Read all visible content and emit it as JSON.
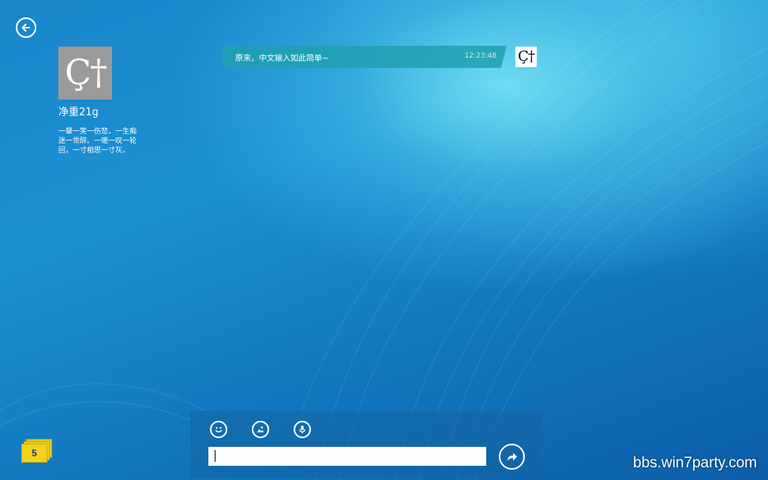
{
  "navigation": {
    "back_icon": "back-arrow-icon"
  },
  "profile": {
    "avatar_glyph": "Ç†",
    "name": "净重21g",
    "bio": "一颦一笑一伤悲，一生痴迷一世醉。一嗟一叹一轮回，一寸相思一寸灰。"
  },
  "conversation": {
    "messages": [
      {
        "text": "原来，中文输入如此简单~",
        "time": "12:23:48",
        "sender_avatar_glyph": "Ç†"
      }
    ]
  },
  "notifications": {
    "unread_count": "5",
    "accent_color": "#f2d21b"
  },
  "compose": {
    "tools": [
      {
        "name": "emoji",
        "icon": "smiley-icon"
      },
      {
        "name": "image",
        "icon": "image-icon"
      },
      {
        "name": "voice",
        "icon": "microphone-icon"
      }
    ],
    "input_value": "",
    "send_icon": "send-arrow-icon"
  },
  "watermark": {
    "text": "bbs.win7party.com"
  },
  "colors": {
    "background": "#1a86cc",
    "bubble": "#20a0b0"
  }
}
